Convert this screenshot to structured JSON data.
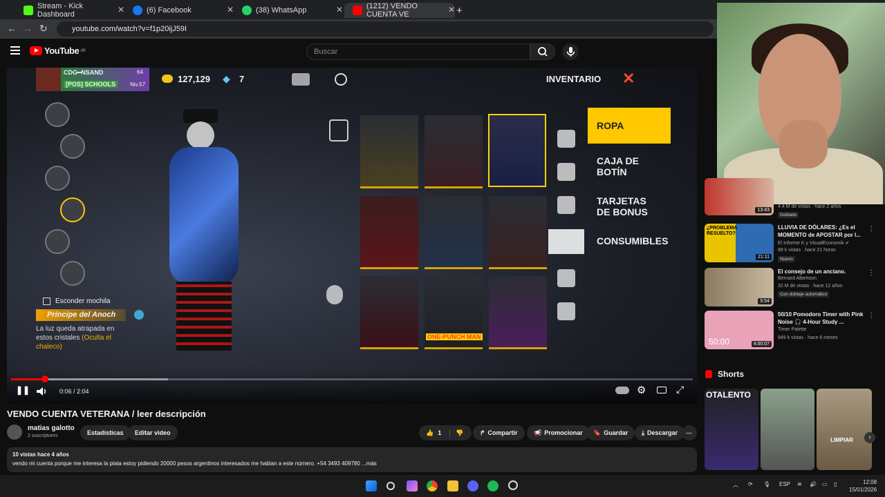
{
  "browser": {
    "tabs": [
      {
        "label": "Stream - Kick Dashboard",
        "color": "#53fc18"
      },
      {
        "label": "(6) Facebook",
        "color": "#1877f2"
      },
      {
        "label": "(38) WhatsApp",
        "color": "#25d366"
      },
      {
        "label": "(1212) VENDO CUENTA VE",
        "color": "#ff0000"
      }
    ],
    "url": "youtube.com/watch?v=f1p20ijJ59I"
  },
  "youtube": {
    "logo": "YouTube",
    "region": "AR",
    "search_placeholder": "Buscar"
  },
  "game": {
    "player_name": "CDG━NSAND",
    "school": "[POS]  SCHOOLS",
    "level_num": "64",
    "level": "Niv.57",
    "coins": "127,129",
    "diamonds": "7",
    "inventory": "INVENTARIO",
    "categories": [
      "ROPA",
      "CAJA DE BOTÍN",
      "TARJETAS DE BONUS",
      "CONSUMIBLES"
    ],
    "hide_backpack": "Esconder mochila",
    "item_name": "Príncipe del Anoch",
    "item_desc": "La luz queda atrapada en estos cristales",
    "item_desc_note": "(Oculta el chaleco)",
    "one_punch": "ONE-PUNCH MAN"
  },
  "player": {
    "time": "0:06 / 2:04",
    "progress": 0.05,
    "buffered": 0.23
  },
  "video": {
    "title": "VENDO CUENTA VETERANA / leer descripción",
    "channel": "matias galotto",
    "subscribers": "2 suscriptores",
    "buttons": {
      "stats": "Estadísticas",
      "edit": "Editar video",
      "likes": "1",
      "share": "Compartir",
      "promote": "Promocionar",
      "save": "Guardar",
      "download": "Descargar"
    },
    "meta": "10 vistas  hace 4 años",
    "description": "vendo mi cuenta porque me interesa la plata estoy pidiendo 20000 pesos argentinos interesados me hablan a este número. +54 3493 409780 ...más"
  },
  "sidebar": {
    "first_meta": "4.4 M de vistas · hace 2 años",
    "first_badge": "Doblado",
    "first_dur": "13:43",
    "recs": [
      {
        "title": "LLUVIA DE DÓLARES: ¿Es el MOMENTO de APOSTAR por l...",
        "channel": "El Informe K y VisualEconomik ✔",
        "meta": "89 k vistas · hace 21 horas",
        "badge": "Nuevo",
        "dur": "21:11",
        "thumb_text": "¿PROBLEMA RESUELTO?"
      },
      {
        "title": "El consejo de un anciano.",
        "channel": "Bernard Albertson",
        "meta": "32 M de vistas · hace 12 años",
        "badge": "Con doblaje automático",
        "dur": "5:54"
      },
      {
        "title": "50/10 Pomodoro Timer with Pink Noise 🎧 4-Hour Study ...",
        "channel": "Timer Palette",
        "meta": "949 k vistas · hace 6 meses",
        "dur": "4:00:07",
        "thumb_text": "50:00"
      }
    ],
    "shorts_label": "Shorts",
    "shorts": [
      {
        "text": "OTALENTO"
      },
      {
        "text": ""
      },
      {
        "text": "LIMPIAR"
      }
    ]
  },
  "taskbar": {
    "lang": "ESP",
    "time": "12:08",
    "date": "15/01/2026"
  }
}
